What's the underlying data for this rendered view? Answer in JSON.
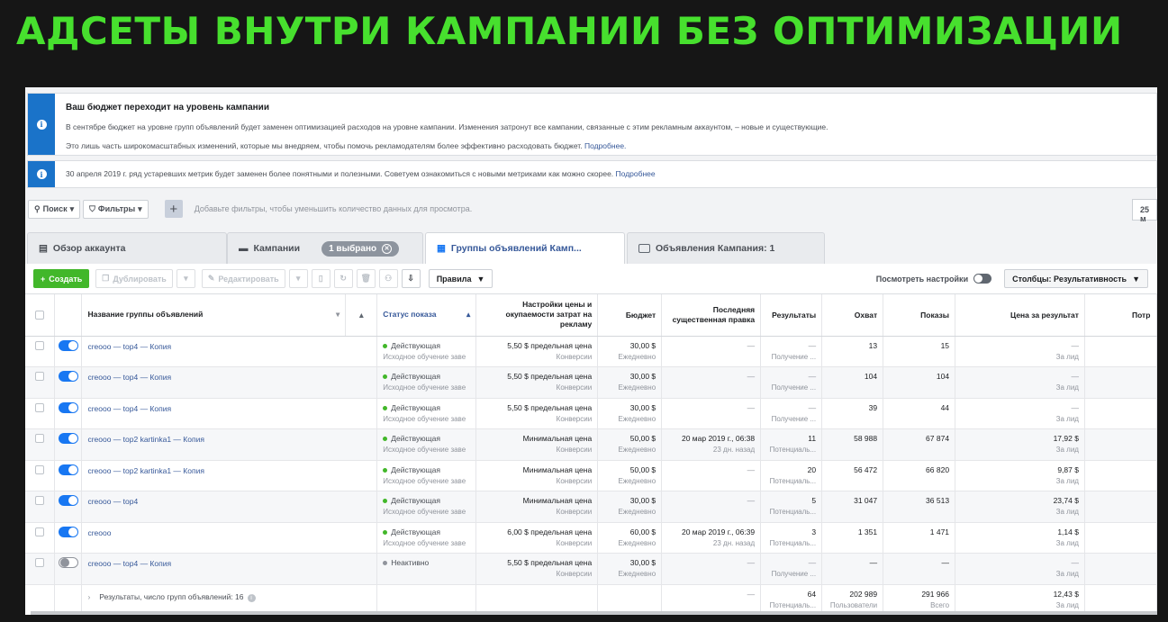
{
  "headline": "АДСЕТЫ ВНУТРИ КАМПАНИИ БЕЗ ОПТИМИЗАЦИИ",
  "notice1": {
    "title": "Ваш бюджет переходит на уровень кампании",
    "line1": "В сентябре бюджет на уровне групп объявлений будет заменен оптимизацией расходов на уровне кампании. Изменения затронут все кампании, связанные с этим рекламным аккаунтом, – новые и существующие.",
    "line2": "Это лишь часть широкомасштабных изменений, которые мы внедряем, чтобы помочь рекламодателям более эффективно расходовать бюджет.",
    "link": "Подробнее."
  },
  "notice2": {
    "line": "30 апреля 2019 г. ряд устаревших метрик будет заменен более понятными и полезными. Советуем ознакомиться с новыми метриками как можно скорее.",
    "link": "Подробнее"
  },
  "filters": {
    "search": "Поиск",
    "filters": "Фильтры",
    "hint": "Добавьте фильтры, чтобы уменьшить количество данных для просмотра.",
    "right": "25 м"
  },
  "tabs": {
    "account": "Обзор аккаунта",
    "campaigns": "Кампании",
    "selected": "1 выбрано",
    "adsets": "Группы объявлений Камп...",
    "ads": "Объявления Кампания: 1"
  },
  "toolbar": {
    "create": "Создать",
    "duplicate": "Дублировать",
    "edit": "Редактировать",
    "rules": "Правила",
    "view_settings": "Посмотреть настройки",
    "columns": "Столбцы: Результативность"
  },
  "columns": {
    "name": "Название группы объявлений",
    "status": "Статус показа",
    "bid": "Настройки цены и окупаемости затрат на рекламу",
    "budget": "Бюджет",
    "last_edit": "Последняя существенная правка",
    "results": "Результаты",
    "reach": "Охват",
    "impressions": "Показы",
    "cpr": "Цена за результат",
    "spent": "Потр"
  },
  "rows": [
    {
      "on": true,
      "name": "creooo — top4 — Копия",
      "status": "Действующая",
      "status_sub": "Исходное обучение заве",
      "bid": "5,50 $ предельная цена",
      "bid_sub": "Конверсии",
      "budget": "30,00 $",
      "budget_sub": "Ежедневно",
      "edit": "—",
      "edit_sub": "",
      "results": "—",
      "results_sub": "Получение ...",
      "reach": "13",
      "impr": "15",
      "cpr": "—",
      "cpr_sub": "За лид"
    },
    {
      "on": true,
      "name": "creooo — top4 — Копия",
      "status": "Действующая",
      "status_sub": "Исходное обучение заве",
      "bid": "5,50 $ предельная цена",
      "bid_sub": "Конверсии",
      "budget": "30,00 $",
      "budget_sub": "Ежедневно",
      "edit": "—",
      "edit_sub": "",
      "results": "—",
      "results_sub": "Получение ...",
      "reach": "104",
      "impr": "104",
      "cpr": "—",
      "cpr_sub": "За лид"
    },
    {
      "on": true,
      "name": "creooo — top4 — Копия",
      "status": "Действующая",
      "status_sub": "Исходное обучение заве",
      "bid": "5,50 $ предельная цена",
      "bid_sub": "Конверсии",
      "budget": "30,00 $",
      "budget_sub": "Ежедневно",
      "edit": "—",
      "edit_sub": "",
      "results": "—",
      "results_sub": "Получение ...",
      "reach": "39",
      "impr": "44",
      "cpr": "—",
      "cpr_sub": "За лид"
    },
    {
      "on": true,
      "name": "creooo — top2 kartinka1 — Копия",
      "status": "Действующая",
      "status_sub": "Исходное обучение заве",
      "bid": "Минимальная цена",
      "bid_sub": "Конверсии",
      "budget": "50,00 $",
      "budget_sub": "Ежедневно",
      "edit": "20 мар 2019 г., 06:38",
      "edit_sub": "23 дн. назад",
      "results": "11",
      "results_sub": "Потенциаль...",
      "reach": "58 988",
      "impr": "67 874",
      "cpr": "17,92 $",
      "cpr_sub": "За лид"
    },
    {
      "on": true,
      "name": "creooo — top2 kartinka1 — Копия",
      "status": "Действующая",
      "status_sub": "Исходное обучение заве",
      "bid": "Минимальная цена",
      "bid_sub": "Конверсии",
      "budget": "50,00 $",
      "budget_sub": "Ежедневно",
      "edit": "—",
      "edit_sub": "",
      "results": "20",
      "results_sub": "Потенциаль...",
      "reach": "56 472",
      "impr": "66 820",
      "cpr": "9,87 $",
      "cpr_sub": "За лид"
    },
    {
      "on": true,
      "name": "creooo — top4",
      "status": "Действующая",
      "status_sub": "Исходное обучение заве",
      "bid": "Минимальная цена",
      "bid_sub": "Конверсии",
      "budget": "30,00 $",
      "budget_sub": "Ежедневно",
      "edit": "—",
      "edit_sub": "",
      "results": "5",
      "results_sub": "Потенциаль...",
      "reach": "31 047",
      "impr": "36 513",
      "cpr": "23,74 $",
      "cpr_sub": "За лид"
    },
    {
      "on": true,
      "name": "creooo",
      "status": "Действующая",
      "status_sub": "Исходное обучение заве",
      "bid": "6,00 $ предельная цена",
      "bid_sub": "Конверсии",
      "budget": "60,00 $",
      "budget_sub": "Ежедневно",
      "edit": "20 мар 2019 г., 06:39",
      "edit_sub": "23 дн. назад",
      "results": "3",
      "results_sub": "Потенциаль...",
      "reach": "1 351",
      "impr": "1 471",
      "cpr": "1,14 $",
      "cpr_sub": "За лид"
    },
    {
      "on": false,
      "name": "creooo — top4 — Копия",
      "status": "Неактивно",
      "status_sub": "",
      "bid": "5,50 $ предельная цена",
      "bid_sub": "Конверсии",
      "budget": "30,00 $",
      "budget_sub": "Ежедневно",
      "edit": "—",
      "edit_sub": "",
      "results": "—",
      "results_sub": "Получение ...",
      "reach": "—",
      "impr": "—",
      "cpr": "—",
      "cpr_sub": "За лид"
    }
  ],
  "summary": {
    "label": "Результаты, число групп объявлений: 16",
    "edit": "—",
    "results": "64",
    "results_sub": "Потенциаль...",
    "reach": "202 989",
    "reach_sub": "Пользователи",
    "impr": "291 966",
    "impr_sub": "Всего",
    "cpr": "12,43 $",
    "cpr_sub": "За лид"
  }
}
